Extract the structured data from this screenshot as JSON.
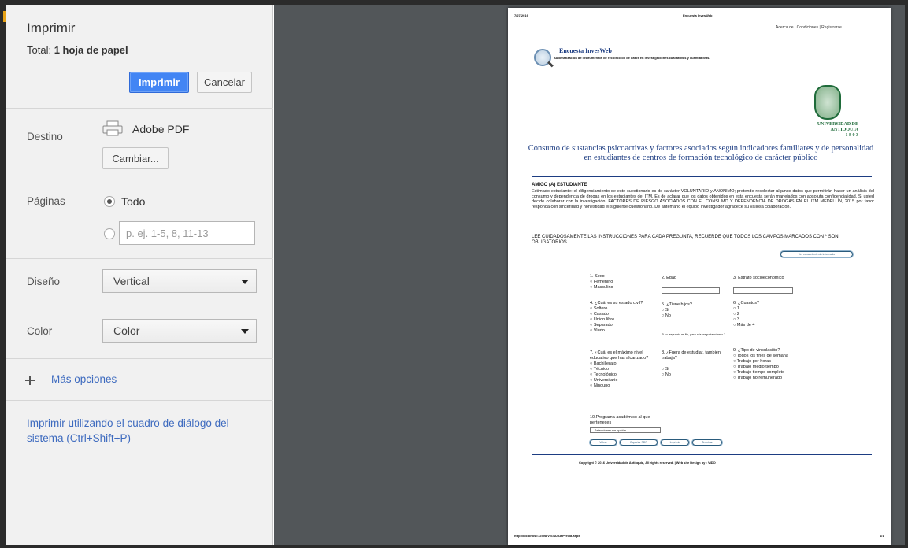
{
  "sidebar": {
    "title": "Imprimir",
    "total_label": "Total:",
    "total_value": "1 hoja de papel",
    "print_button": "Imprimir",
    "cancel_button": "Cancelar",
    "destination": {
      "label": "Destino",
      "printer_name": "Adobe PDF",
      "change_button": "Cambiar..."
    },
    "pages": {
      "label": "Páginas",
      "option_all": "Todo",
      "option_all_selected": true,
      "range_placeholder": "p. ej. 1-5, 8, 11-13"
    },
    "layout": {
      "label": "Diseño",
      "selected": "Vertical"
    },
    "color": {
      "label": "Color",
      "selected": "Color"
    },
    "more_options": "Más opciones",
    "system_dialog_link": "Imprimir utilizando el cuadro de diálogo del sistema (Ctrl+Shift+P)"
  },
  "preview": {
    "header_left": "7/27/2016",
    "header_center": "Encuesta InvesWeb",
    "nav": "Acerca de  |  Condiciones  |  Registrarse",
    "brand": "Encuesta InvesWeb",
    "brand_sub": "Automatización de instrumentos de recolección de datos en investigaciones cualitativas y cuantitativas.",
    "university": "UNIVERSIDAD DE ANTIOQUIA",
    "university_year": "1 8 0 3",
    "study_title": "Consumo de sustancias psicoactivas y factores asociados según indicadores familiares y de personalidad en estudiantes de centros de formación tecnológico de carácter público",
    "greeting": "AMIGO (A)  ESTUDIANTE",
    "intro": "Estimado estudiante: el diligenciamiento de este cuestionario es de carácter VOLUNTARIO y ANONIMO; pretende recolectar algunos datos que permitirán hacer un análisis del consumo y dependencia de drogas en los estudiantes del ITM. Es de aclarar que los datos obtenidos en esta encuesta serán manejados con absoluta confidencialidad. Si usted decide colaborar con la investigación: FACTORES DE RIESGO ASOCIADOS CON EL CONSUMO Y DEPENDENCIA DE DROGAS EN EL ITM MEDELLÍN, 2015 por favor responda con sinceridad y honestidad el siguiente cuestionario. De antemano el equipo investigador agradece su valiosa colaboración.",
    "instructions": "LEE CUIDADOSAMENTE LAS INSTRUCCIONES PARA CADA PREGUNTA, RECUERDE QUE TODOS LOS CAMPOS MARCADOS CON * SON OBLIGATORIOS.",
    "consent_button": "Ver consentimiento informado",
    "q1": {
      "label": "1. Sexo",
      "options": [
        "Femenino",
        "Masculino"
      ]
    },
    "q2": {
      "label": "2. Edad"
    },
    "q3": {
      "label": "3. Estrato socioeconomico"
    },
    "q4": {
      "label": "4. ¿Cuál es su estado civil?",
      "options": [
        "Soltero",
        "Casado",
        "Union libre",
        "Separado",
        "Viudo"
      ]
    },
    "q5": {
      "label": "5. ¿Tiene hijos?",
      "options": [
        "Si",
        "No"
      ],
      "note": "Si su respuesta es No, pase a la pregunta número 7"
    },
    "q6": {
      "label": "6. ¿Cuantos?",
      "options": [
        "1",
        "2",
        "3",
        "Más de 4"
      ]
    },
    "q7": {
      "label": "7. ¿Cuál es el máximo nivel educativo que has alcanzado?",
      "options": [
        "Bachillerato",
        "Técnico",
        "Tecnológico",
        "Universitario",
        "Ninguno"
      ]
    },
    "q8": {
      "label": "8. ¿Fuera de estudiar, también trabaja?",
      "options": [
        "Si",
        "No"
      ]
    },
    "q9": {
      "label": "9. ¿Tipo de vinculación?",
      "options": [
        "Todos los fines de semana",
        "Trabajo por horas",
        "Trabajo medio tiempo",
        "Trabajo tiempo completo",
        "Trabajo no remunerado"
      ]
    },
    "q10": {
      "label": "10.Programa académico al que perteneces",
      "select": "--Seleccione una opción--"
    },
    "buttons": [
      "Volver",
      "Exportar PDF",
      "Imprimir",
      "Terminar"
    ],
    "copyright": "Copyright © 2016 Universidad de Antioquia, All rights reserved. | Web site Design by : VIDO",
    "footer_url": "http://localhost:12598/VISTA/ActPrevia.aspx",
    "page_number": "1/1"
  }
}
